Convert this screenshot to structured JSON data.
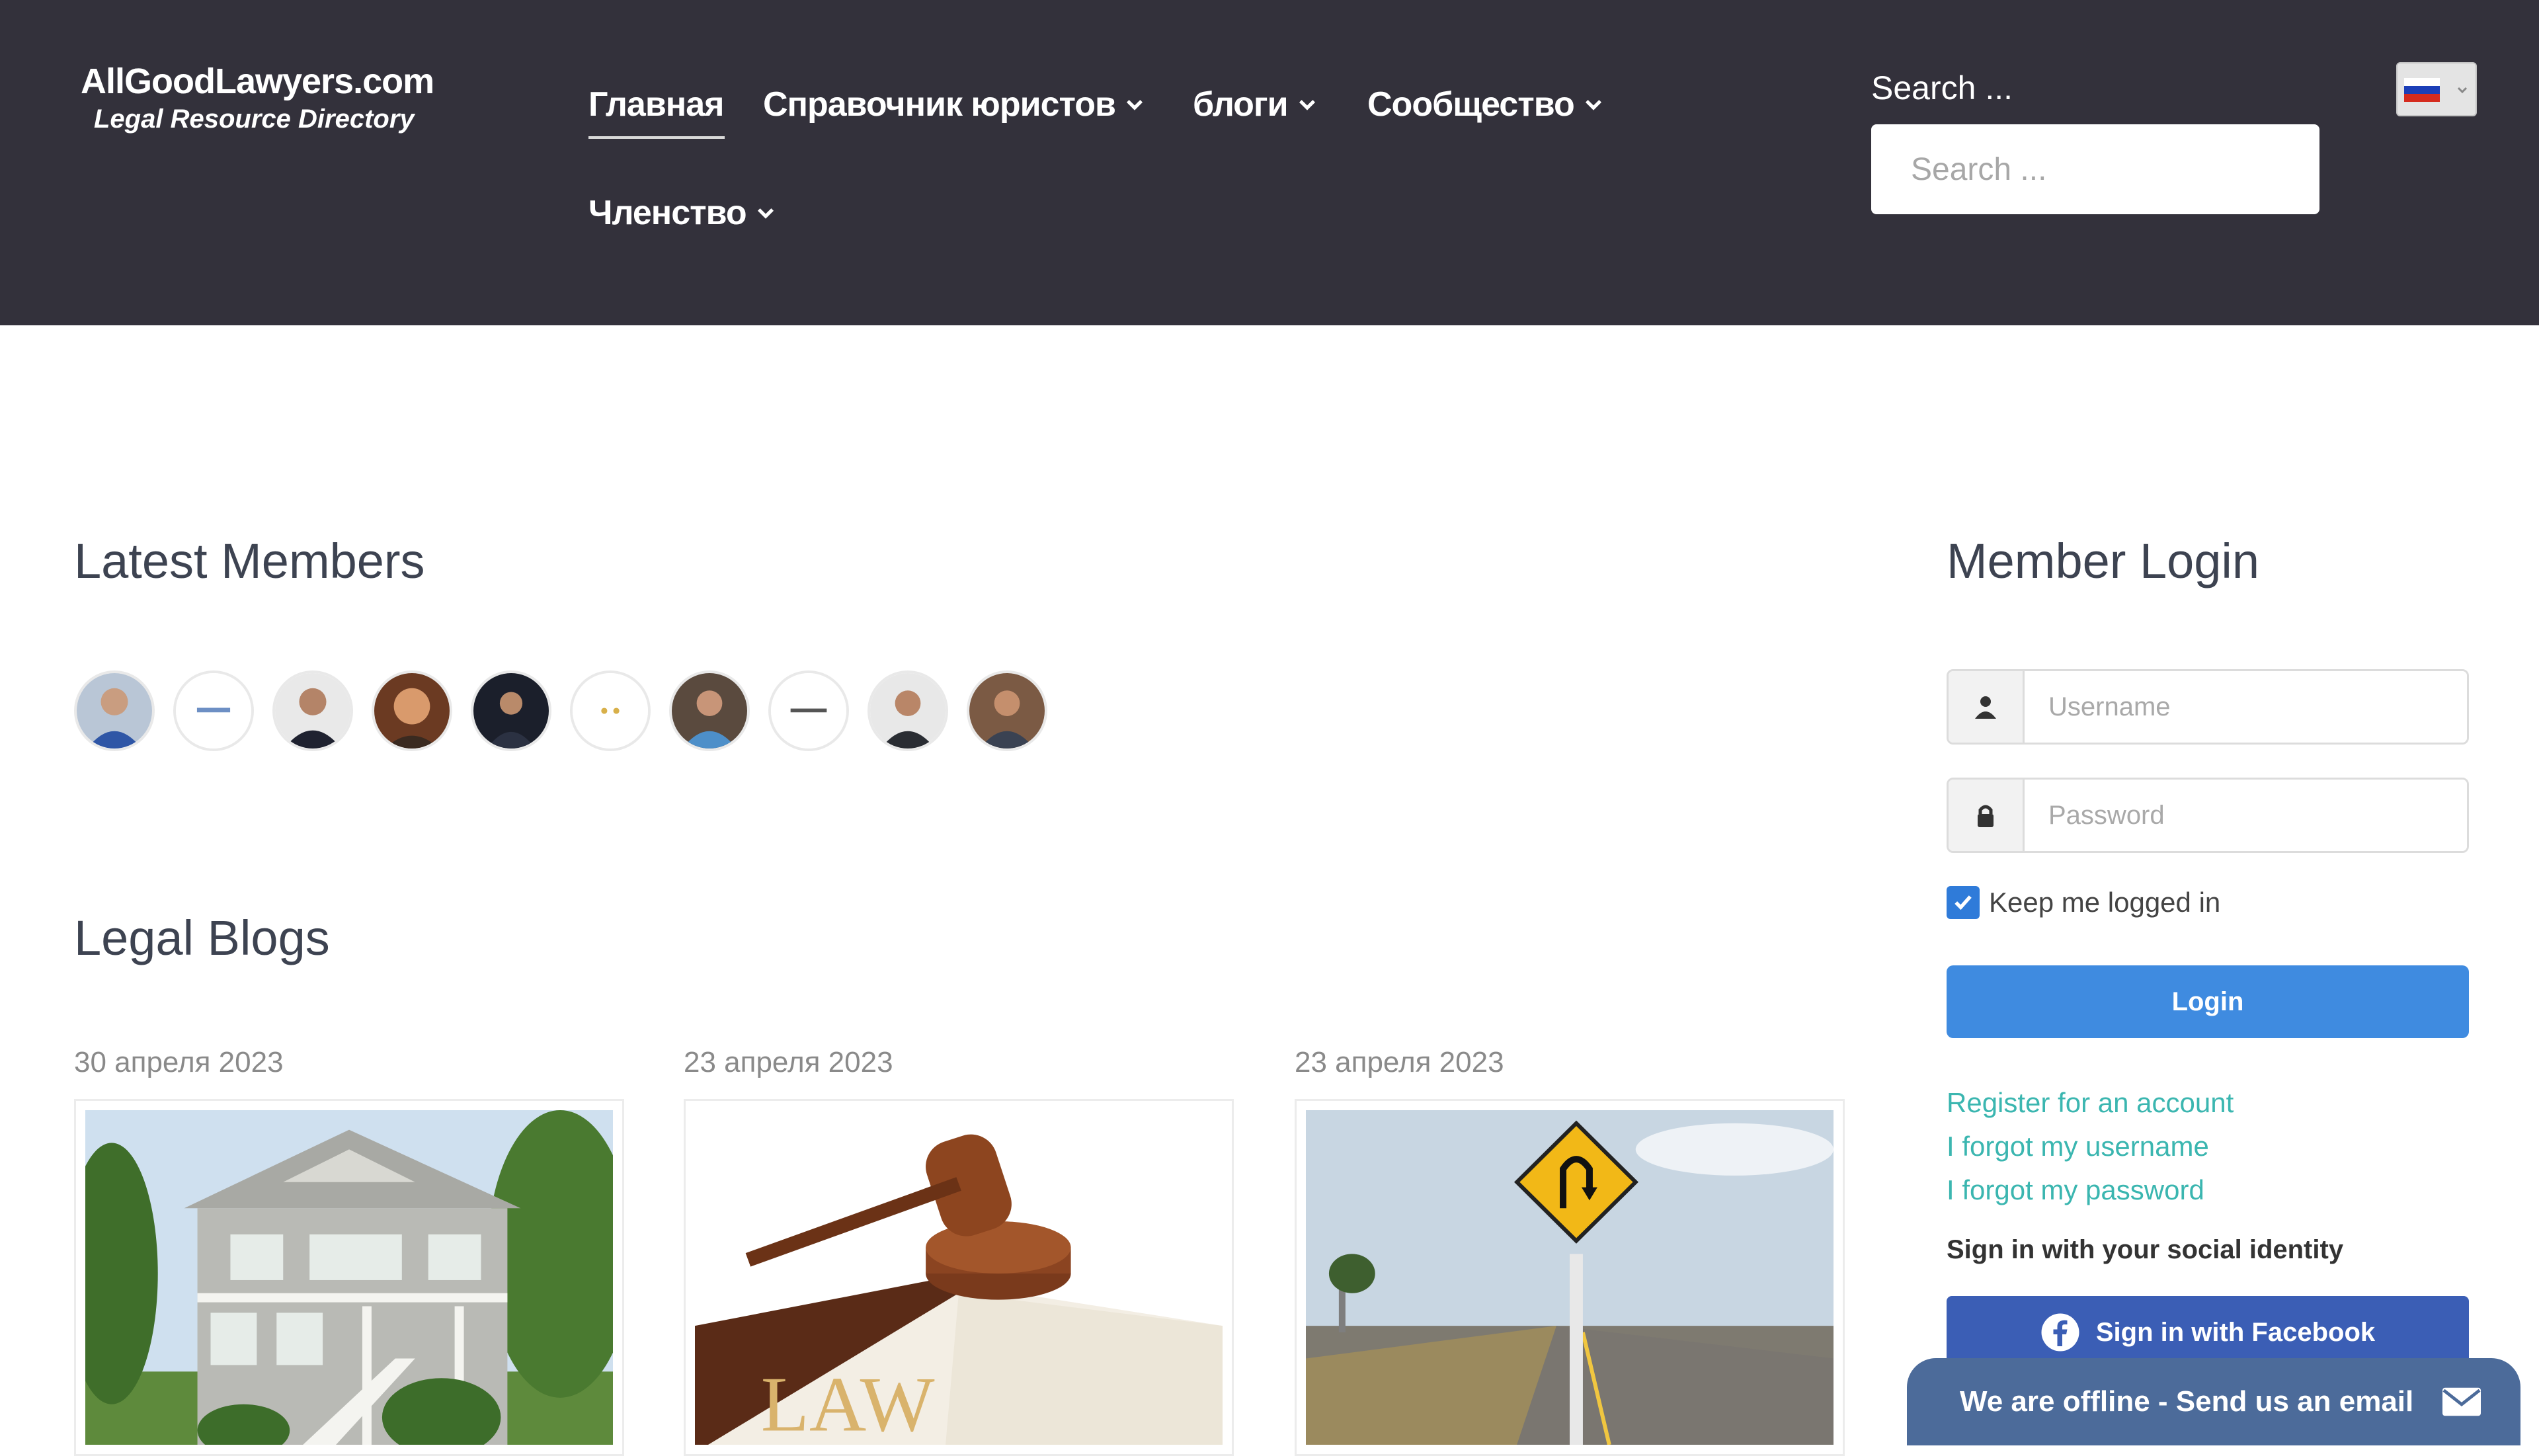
{
  "site": {
    "title": "AllGoodLawyers.com",
    "tagline": "Legal Resource Directory"
  },
  "nav": {
    "items": [
      {
        "label": "Главная",
        "active": true
      },
      {
        "label": "Справочник юристов",
        "dropdown": true
      },
      {
        "label": "блоги",
        "dropdown": true
      },
      {
        "label": "Сообщество",
        "dropdown": true
      },
      {
        "label": "Членство",
        "dropdown": true
      }
    ]
  },
  "search": {
    "label": "Search ...",
    "placeholder": "Search ..."
  },
  "language": {
    "flag": "russia-flag-icon"
  },
  "latest_members": {
    "title": "Latest Members",
    "avatars": [
      "member-1",
      "member-2-logo",
      "member-3",
      "member-4",
      "member-5",
      "member-6-logo",
      "member-7",
      "member-8-logo",
      "member-9",
      "member-10"
    ]
  },
  "blogs": {
    "title": "Legal Blogs",
    "posts": [
      {
        "date": "30 апреля 2023",
        "image": "house"
      },
      {
        "date": "23 апреля 2023",
        "image": "gavel-law-book",
        "image_text": "LAW"
      },
      {
        "date": "23 апреля 2023",
        "image": "u-turn-sign"
      }
    ]
  },
  "login": {
    "title": "Member Login",
    "username_placeholder": "Username",
    "password_placeholder": "Password",
    "remember_label": "Keep me logged in",
    "remember_checked": true,
    "login_button": "Login",
    "links": [
      "Register for an account",
      "I forgot my username",
      "I forgot my password"
    ],
    "social_heading": "Sign in with your social identity",
    "facebook_button": "Sign in with Facebook"
  },
  "chat": {
    "label": "We are offline - Send us an email"
  },
  "colors": {
    "header_bg": "#33313b",
    "accent_blue": "#3f8be0",
    "link_teal": "#3bb6b0",
    "facebook": "#3b5eb5",
    "chat": "#4c6b9a"
  }
}
